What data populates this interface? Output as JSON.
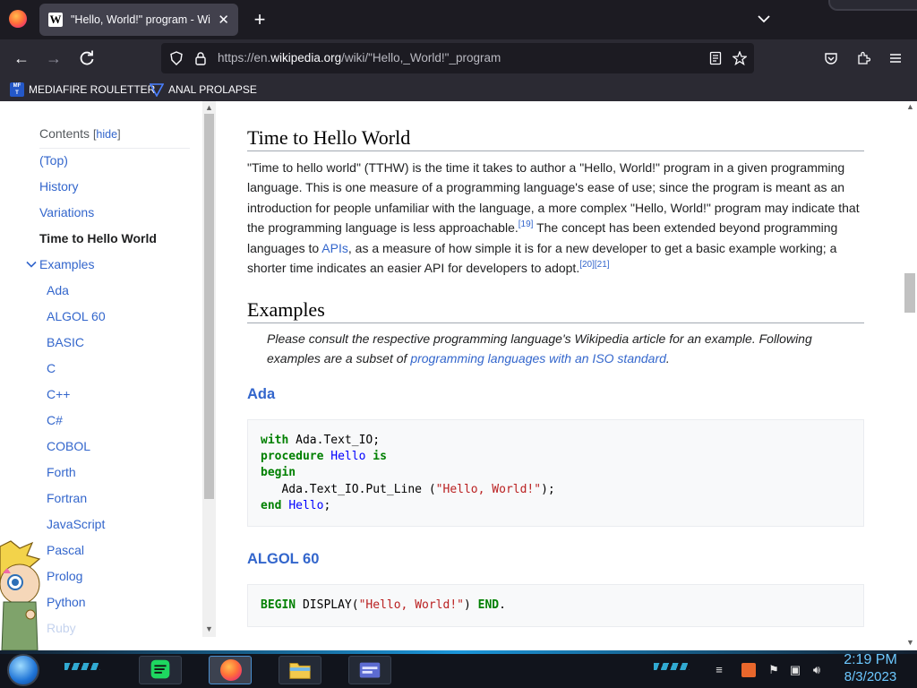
{
  "browser": {
    "tab": {
      "title": "\"Hello, World!\" program - Wikipedia",
      "favicon": "W"
    },
    "url": {
      "prefix": "https://en.",
      "domain": "wikipedia.org",
      "path": "/wiki/\"Hello,_World!\"_program"
    },
    "bookmarks": [
      {
        "label": "MEDIAFIRE ROULETTER",
        "icon": "mediafire-icon",
        "icon_text": "MF\nT"
      },
      {
        "label": "ANAL PROLAPSE",
        "icon": "triangle-icon"
      }
    ]
  },
  "toc": {
    "title": "Contents",
    "hide_label": "hide",
    "items": [
      {
        "label": "(Top)"
      },
      {
        "label": "History"
      },
      {
        "label": "Variations"
      },
      {
        "label": "Time to Hello World"
      },
      {
        "label": "Examples"
      },
      {
        "label": "Ada"
      },
      {
        "label": "ALGOL 60"
      },
      {
        "label": "BASIC"
      },
      {
        "label": "C"
      },
      {
        "label": "C++"
      },
      {
        "label": "C#"
      },
      {
        "label": "COBOL"
      },
      {
        "label": "Forth"
      },
      {
        "label": "Fortran"
      },
      {
        "label": "JavaScript"
      },
      {
        "label": "Pascal"
      },
      {
        "label": "Prolog"
      },
      {
        "label": "Python"
      },
      {
        "label": "Ruby"
      }
    ]
  },
  "article": {
    "tthw": {
      "heading": "Time to Hello World",
      "p1": "\"Time to hello world\" (TTHW) is the time it takes to author a \"Hello, World!\" program in a given programming language. This is one measure of a programming language's ease of use; since the program is meant as an introduction for people unfamiliar with the language, a more complex \"Hello, World!\" program may indicate that the programming language is less approachable.",
      "ref1": "[19]",
      "p2": " The concept has been extended beyond programming languages to ",
      "apis_link": "APIs",
      "p3": ", as a measure of how simple it is for a new developer to get a basic example working; a shorter time indicates an easier API for developers to adopt.",
      "ref2": "[20]",
      "ref3": "[21]"
    },
    "examples": {
      "heading": "Examples",
      "hatnote_pre": "Please consult the respective programming language's Wikipedia article for an example. Following examples are a subset of ",
      "hatnote_link": "programming languages with an ISO standard",
      "hatnote_post": "."
    },
    "ada": {
      "heading": "Ada",
      "line1_kw": "with",
      "line1_rest": " Ada.Text_IO;",
      "line2_kw": "procedure",
      "line2_name": "Hello",
      "line2_kw2": "is",
      "line3_kw": "begin",
      "line4_pre": "   Ada.Text_IO.Put_Line (",
      "line4_str": "\"Hello, World!\"",
      "line4_post": ");",
      "line5_kw": "end",
      "line5_name": "Hello",
      "line5_post": ";"
    },
    "algol": {
      "heading": "ALGOL 60",
      "kw1": "BEGIN",
      "mid": " DISPLAY(",
      "str": "\"Hello, World!\"",
      "post": ") ",
      "kw2": "END",
      "end": "."
    }
  },
  "taskbar": {
    "time": "2:19 PM",
    "date": "8/3/2023"
  }
}
